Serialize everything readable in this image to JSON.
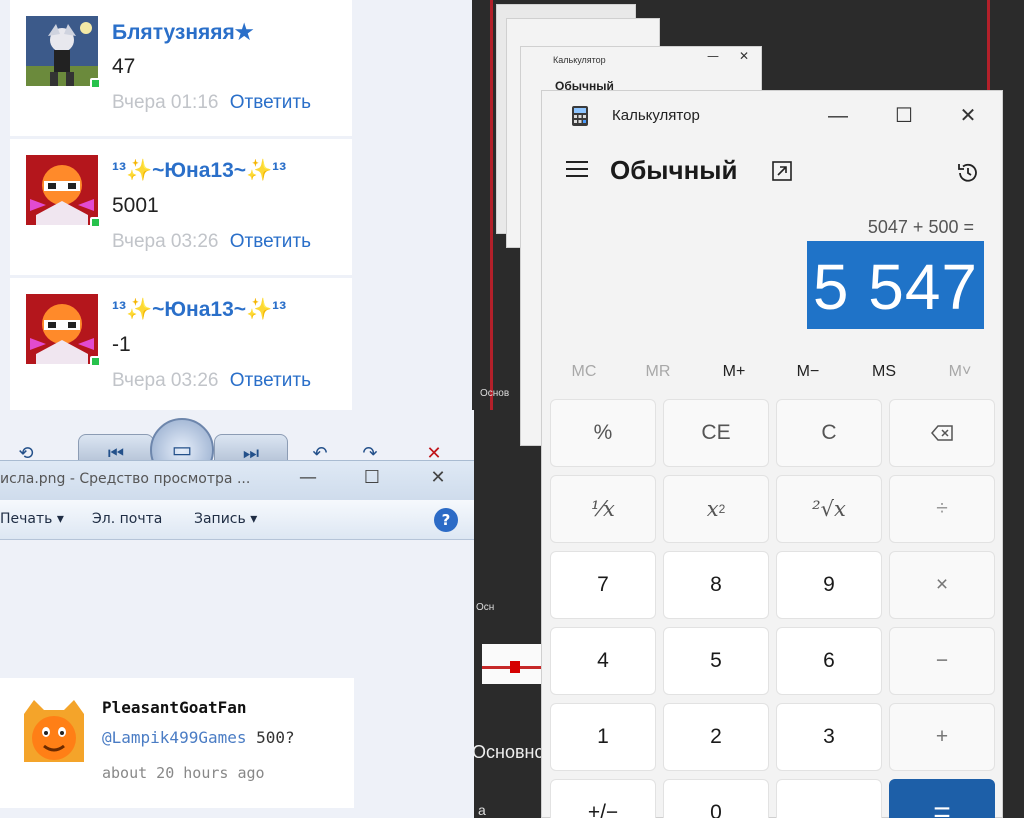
{
  "feed": {
    "comments": [
      {
        "author": "Блятузняяя★",
        "text": "47",
        "time": "Вчера 01:16",
        "reply": "Ответить"
      },
      {
        "author": "¹³✨~Юна13~✨¹³",
        "text": "5001",
        "time": "Вчера 03:26",
        "reply": "Ответить"
      },
      {
        "author": "¹³✨~Юна13~✨¹³",
        "text": "-1",
        "time": "Вчера 03:26",
        "reply": "Ответить"
      }
    ]
  },
  "viewer": {
    "title": "исла.png - Средство просмотра ...",
    "menu": [
      "Печать",
      "Эл. почта",
      "Запись"
    ],
    "window_controls": [
      "—",
      "☐",
      "✕"
    ]
  },
  "tweet": {
    "author": "PleasantGoatFan",
    "mention": "@Lampik499Games",
    "text": " 500?",
    "time": "about 20 hours ago"
  },
  "darkbg": {
    "label_main": "Основнс",
    "label_small": "Основ",
    "label_small2": "Осн",
    "label_k": "а"
  },
  "calculator": {
    "app_title": "Калькулятор",
    "mode": "Обычный",
    "expression": "5047 + 500 =",
    "result": "5 547",
    "memory": [
      {
        "label": "MC",
        "enabled": false
      },
      {
        "label": "MR",
        "enabled": false
      },
      {
        "label": "M+",
        "enabled": true
      },
      {
        "label": "M−",
        "enabled": true
      },
      {
        "label": "MS",
        "enabled": true
      },
      {
        "label": "M˅",
        "enabled": false
      }
    ],
    "keys": {
      "percent": "%",
      "ce": "CE",
      "c": "C",
      "reciprocal": "¹⁄x",
      "square": "x",
      "square_sup": "2",
      "sqrt": "²√x",
      "divide": "÷",
      "d7": "7",
      "d8": "8",
      "d9": "9",
      "multiply": "×",
      "d4": "4",
      "d5": "5",
      "d6": "6",
      "minus": "−",
      "d1": "1",
      "d2": "2",
      "d3": "3",
      "plus": "+",
      "negate": "+/−",
      "d0": "0",
      "dot": "",
      "equals": "="
    },
    "accent": "#1f73c8"
  }
}
